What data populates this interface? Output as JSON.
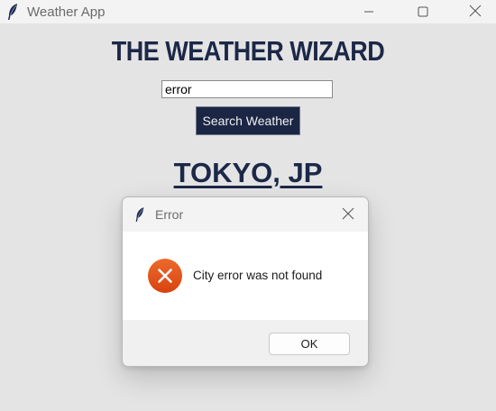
{
  "window": {
    "title": "Weather App",
    "icons": {
      "app": "feather-icon",
      "minimize": "minimize-icon",
      "maximize": "maximize-icon",
      "close": "close-icon"
    }
  },
  "main": {
    "heading": "THE WEATHER WIZARD",
    "search_value": "error",
    "search_button_label": "Search Weather",
    "city": "TOKYO, JP"
  },
  "dialog": {
    "title": "Error",
    "message": "City error was not found",
    "ok_label": "OK",
    "icons": {
      "app": "feather-icon",
      "close": "close-icon",
      "status": "error-icon"
    }
  },
  "colors": {
    "background": "#e4e4e4",
    "heading": "#1c2847",
    "button": "#1b2645",
    "error_icon": "#e0501d"
  }
}
